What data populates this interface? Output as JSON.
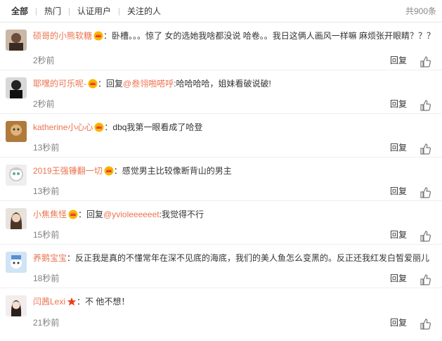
{
  "tabs": [
    {
      "label": "全部",
      "active": true
    },
    {
      "label": "热门",
      "active": false
    },
    {
      "label": "认证用户",
      "active": false
    },
    {
      "label": "关注的人",
      "active": false
    }
  ],
  "total": "共900条",
  "reply_label": "回复",
  "colors": {
    "username": "#eb7350",
    "time": "#808080",
    "badge": "#f7b500"
  },
  "comments": [
    {
      "user": "硕哥的小熊软糖",
      "sep": "：",
      "text": "卧槽。。。惊了 女的选她我啥都没说 哈卷。。我日这俩人画风一样嘛 麻烦张开眼睛？？？",
      "time": "2秒前",
      "badge": "vip-crown-icon"
    },
    {
      "user": "耶嘿的可乐呢-",
      "sep": "：",
      "reply_prefix": "回复",
      "reply_to": "@叁翎啪嗒呼",
      "text": ":哈哈哈哈，姐妹看破说破!",
      "time": "2秒前",
      "badge": "vip-crown-icon"
    },
    {
      "user": "katherine小心心",
      "sep": "：",
      "text": "dbq我第一眼看成了哈登",
      "time": "13秒前",
      "badge": "vip-crown-icon"
    },
    {
      "user": "2019王强锤翻一切",
      "sep": "：",
      "text": "感觉男主比较像断背山的男主",
      "time": "13秒前",
      "badge": "vip-crown-icon"
    },
    {
      "user": "小焦焦怪",
      "sep": "：",
      "reply_prefix": "回复",
      "reply_to": "@yvioleeeeeet",
      "text": ":我觉得不行",
      "time": "15秒前",
      "badge": "vip-crown-icon"
    },
    {
      "user": "养鹅宝宝",
      "sep": "：",
      "text": "反正我是真的不懂常年在深不见底的海底，我们的美人鱼怎么变黑的。反正还我红发白皙爱丽儿",
      "time": "18秒前",
      "badge": "vip-crown-icon"
    },
    {
      "user": "闫茜Lexi",
      "sep": "：",
      "text": "不 他不想！",
      "time": "21秒前",
      "badge": "star-icon"
    }
  ]
}
